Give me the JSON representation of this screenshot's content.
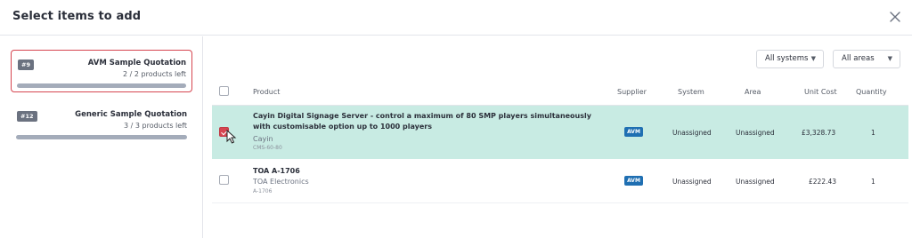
{
  "modal": {
    "title": "Select items to add"
  },
  "quotations": [
    {
      "id": "#9",
      "name": "AVM Sample Quotation",
      "products_left": "2 / 2 products left",
      "selected": true
    },
    {
      "id": "#12",
      "name": "Generic Sample Quotation",
      "products_left": "3 / 3 products left",
      "selected": false
    }
  ],
  "filters": {
    "systems": "All systems",
    "areas": "All areas"
  },
  "table": {
    "columns": {
      "product": "Product",
      "supplier": "Supplier",
      "system": "System",
      "area": "Area",
      "unit_cost": "Unit Cost",
      "quantity": "Quantity"
    },
    "rows": [
      {
        "checked": true,
        "name": "Cayin Digital Signage Server - control a maximum of 80 SMP players simultaneously with customisable option up to 1000 players",
        "brand": "Cayin",
        "code": "CMS-60-80",
        "supplier": "AVM",
        "system": "Unassigned",
        "area": "Unassigned",
        "unit_cost": "£3,328.73",
        "quantity": "1"
      },
      {
        "checked": false,
        "name": "TOA A-1706",
        "brand": "TOA Electronics",
        "code": "A-1706",
        "supplier": "AVM",
        "system": "Unassigned",
        "area": "Unassigned",
        "unit_cost": "£222.43",
        "quantity": "1"
      }
    ]
  },
  "colors": {
    "selected_row": "#c8ebe3",
    "selected_card_border": "#d64550",
    "checkbox_checked": "#d64550",
    "supplier_badge": "#1f6fb2",
    "progress_bar": "#a4acba"
  },
  "icons": {
    "close": "close-icon",
    "caret": "caret-down-icon",
    "cursor": "mouse-pointer-icon"
  }
}
